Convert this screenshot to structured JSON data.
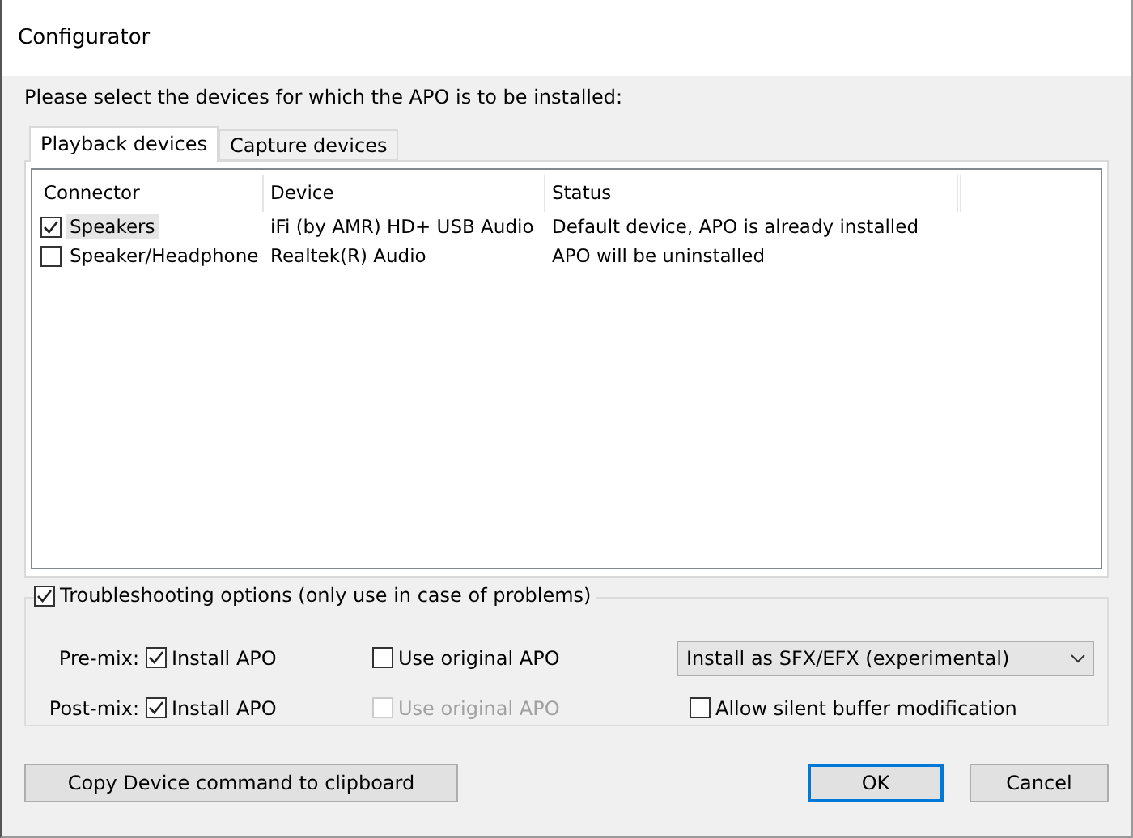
{
  "window": {
    "title": "Configurator"
  },
  "instruction": "Please select the devices for which the APO is to be installed:",
  "tabs": [
    {
      "label": "Playback devices",
      "selected": true
    },
    {
      "label": "Capture devices",
      "selected": false
    }
  ],
  "table": {
    "columns": [
      "Connector",
      "Device",
      "Status"
    ],
    "rows": [
      {
        "connector": "Speakers",
        "device": "iFi (by AMR) HD+ USB Audio",
        "status": "Default device, APO is already installed",
        "checked": true,
        "selected": true
      },
      {
        "connector": "Speaker/Headphone",
        "device": "Realtek(R) Audio",
        "status": "APO will be uninstalled",
        "checked": false,
        "selected": false
      }
    ]
  },
  "troubleshooting": {
    "label": "Troubleshooting options (only use in case of problems)",
    "checked": true,
    "mixes": [
      {
        "label": "Pre-mix:",
        "install": {
          "label": "Install APO",
          "checked": true,
          "disabled": false
        },
        "original": {
          "label": "Use original APO",
          "checked": false,
          "disabled": false
        }
      },
      {
        "label": "Post-mix:",
        "install": {
          "label": "Install APO",
          "checked": true,
          "disabled": false
        },
        "original": {
          "label": "Use original APO",
          "checked": false,
          "disabled": true
        }
      }
    ],
    "mode": {
      "value": "Install as SFX/EFX (experimental)"
    },
    "silent": {
      "label": "Allow silent buffer modification",
      "checked": false,
      "disabled": false
    }
  },
  "buttons": [
    {
      "label": "Copy Device command to clipboard",
      "kind": "secondary"
    },
    {
      "label": "OK",
      "kind": "default"
    },
    {
      "label": "Cancel",
      "kind": "secondary"
    }
  ]
}
